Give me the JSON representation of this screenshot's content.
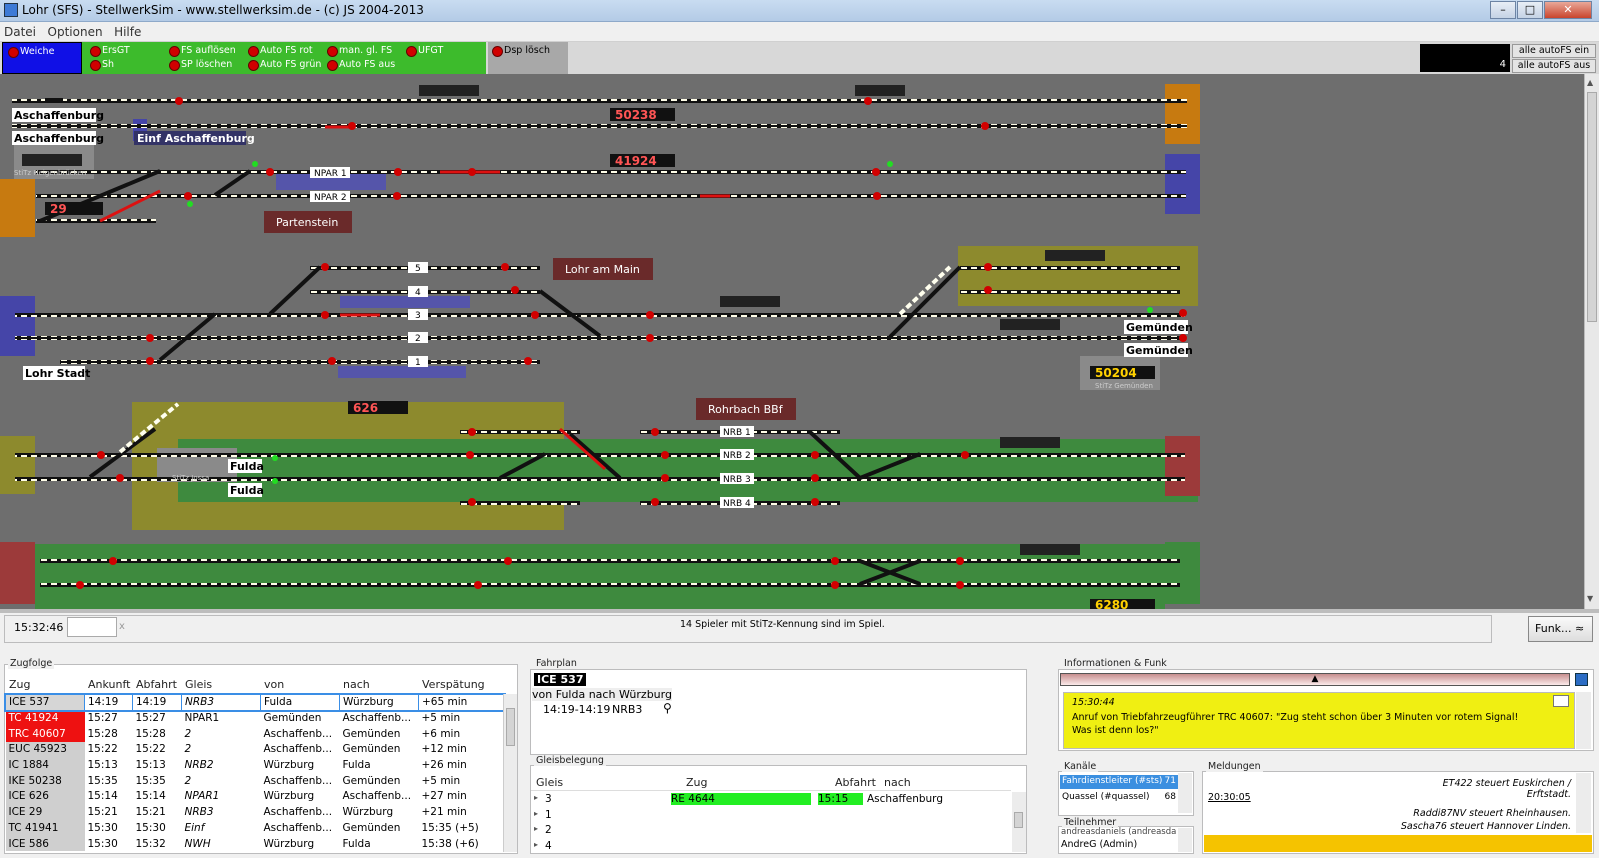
{
  "window": {
    "title": "Lohr (SFS) - StellwerkSim - www.stellwerksim.de - (c) JS 2004-2013"
  },
  "menu": [
    "Datei",
    "Optionen",
    "Hilfe"
  ],
  "toolbar": {
    "weiche": "Weiche",
    "group1": [
      "ErsGT",
      "Sh"
    ],
    "group2": [
      "FS auflösen",
      "SP löschen"
    ],
    "group3": [
      "Auto FS rot",
      "Auto FS grün"
    ],
    "group4": [
      "man. gl. FS",
      "Auto FS aus"
    ],
    "group5": [
      "UFGT"
    ],
    "dsp": "Dsp lösch",
    "counter": "4",
    "alle_ein": "alle autoFS ein",
    "alle_aus": "alle autoFS aus"
  },
  "board": {
    "stations": [
      "Aschaffenburg",
      "Aschaffenburg",
      "Einf Aschaffenburg",
      "StiTz Heigenbrücken",
      "Partenstein",
      "Lohr am Main",
      "Lohr Stadt",
      "Gemünden",
      "Gemünden",
      "StiTz Gemünden",
      "Rohrbach BBf",
      "Fulda",
      "Fulda",
      "StiTz Jossa"
    ],
    "track_labels": [
      "NPAR 1",
      "NPAR 2",
      "5",
      "4",
      "3",
      "2",
      "1",
      "NRB 1",
      "NRB 2",
      "NRB 3",
      "NRB 4"
    ],
    "train_displays": [
      "50238",
      "41924",
      "29",
      "626",
      "50204",
      "6280"
    ]
  },
  "status": {
    "time": "15:32:46",
    "info": "14 Spieler mit StiTz-Kennung sind im Spiel.",
    "funk_button": "Funk..."
  },
  "zugfolge": {
    "title": "Zugfolge",
    "headers": [
      "Zug",
      "Ankunft",
      "Abfahrt",
      "Gleis",
      "von",
      "nach",
      "Verspätung"
    ],
    "rows": [
      [
        "ICE 537",
        "14:19",
        "14:19",
        "NRB3",
        "Fulda",
        "Würzburg",
        "+65 min"
      ],
      [
        "TC 41924",
        "15:27",
        "15:27",
        "NPAR1",
        "Gemünden",
        "Aschaffenb...",
        "+5 min"
      ],
      [
        "TRC 40607",
        "15:28",
        "15:28",
        "2",
        "Aschaffenb...",
        "Gemünden",
        "+6 min"
      ],
      [
        "EUC 45923",
        "15:22",
        "15:22",
        "2",
        "Aschaffenb...",
        "Gemünden",
        "+12 min"
      ],
      [
        "IC 1884",
        "15:13",
        "15:13",
        "NRB2",
        "Würzburg",
        "Fulda",
        "+26 min"
      ],
      [
        "IKE 50238",
        "15:35",
        "15:35",
        "2",
        "Aschaffenb...",
        "Gemünden",
        "+5 min"
      ],
      [
        "ICE 626",
        "15:14",
        "15:14",
        "NPAR1",
        "Würzburg",
        "Aschaffenb...",
        "+27 min"
      ],
      [
        "ICE 29",
        "15:21",
        "15:21",
        "NRB3",
        "Aschaffenb...",
        "Würzburg",
        "+21 min"
      ],
      [
        "TC 41941",
        "15:30",
        "15:30",
        "Einf",
        "Aschaffenb...",
        "Gemünden",
        "15:35 (+5)"
      ],
      [
        "ICE 586",
        "15:30",
        "15:32",
        "NWH",
        "Würzburg",
        "Fulda",
        "15:38 (+6)"
      ]
    ]
  },
  "fahrplan": {
    "title": "Fahrplan",
    "train": "ICE 537",
    "von_label": "von",
    "von": "Fulda",
    "nach_label": "nach",
    "nach": "Würzburg",
    "zeit": "14:19-14:19",
    "gleis": "NRB3"
  },
  "gleisbelegung": {
    "title": "Gleisbelegung",
    "headers": [
      "Gleis",
      "Zug",
      "Abfahrt",
      "nach"
    ],
    "rows": [
      [
        "3",
        "RE 4644",
        "15:15",
        "Aschaffenburg"
      ],
      [
        "1",
        "",
        "",
        ""
      ],
      [
        "2",
        "",
        "",
        ""
      ],
      [
        "4",
        "",
        "",
        ""
      ]
    ]
  },
  "info": {
    "title": "Informationen & Funk",
    "time": "15:30:44",
    "message": "Anruf von Triebfahrzeugführer TRC 40607: \"Zug steht schon über 3 Minuten vor rotem Signal! Was ist denn los?\""
  },
  "kanaele": {
    "title": "Kanäle",
    "items": [
      {
        "name": "Fahrdienstleiter (#sts)",
        "count": "71"
      },
      {
        "name": "Quassel (#quassel)",
        "count": "68"
      }
    ]
  },
  "teilnehmer": {
    "title": "Teilnehmer",
    "items": [
      "andreasdaniels (andreasda",
      "AndreG (Admin)"
    ]
  },
  "meldungen": {
    "title": "Meldungen",
    "time": "20:30:05",
    "lines": [
      "ET422 steuert Euskirchen / Erftstadt.",
      "Raddi87NV steuert Rheinhausen.",
      "Sascha76 steuert Hannover Linden."
    ]
  },
  "colors": {
    "toolbar_green": "#3dbb2c",
    "weiche_blue": "#1010e6",
    "board_gray": "#6e6e6e",
    "highlight_yellow": "#f0ef12",
    "track_dash": "#ffffee",
    "delay_red": "#ee1111"
  }
}
